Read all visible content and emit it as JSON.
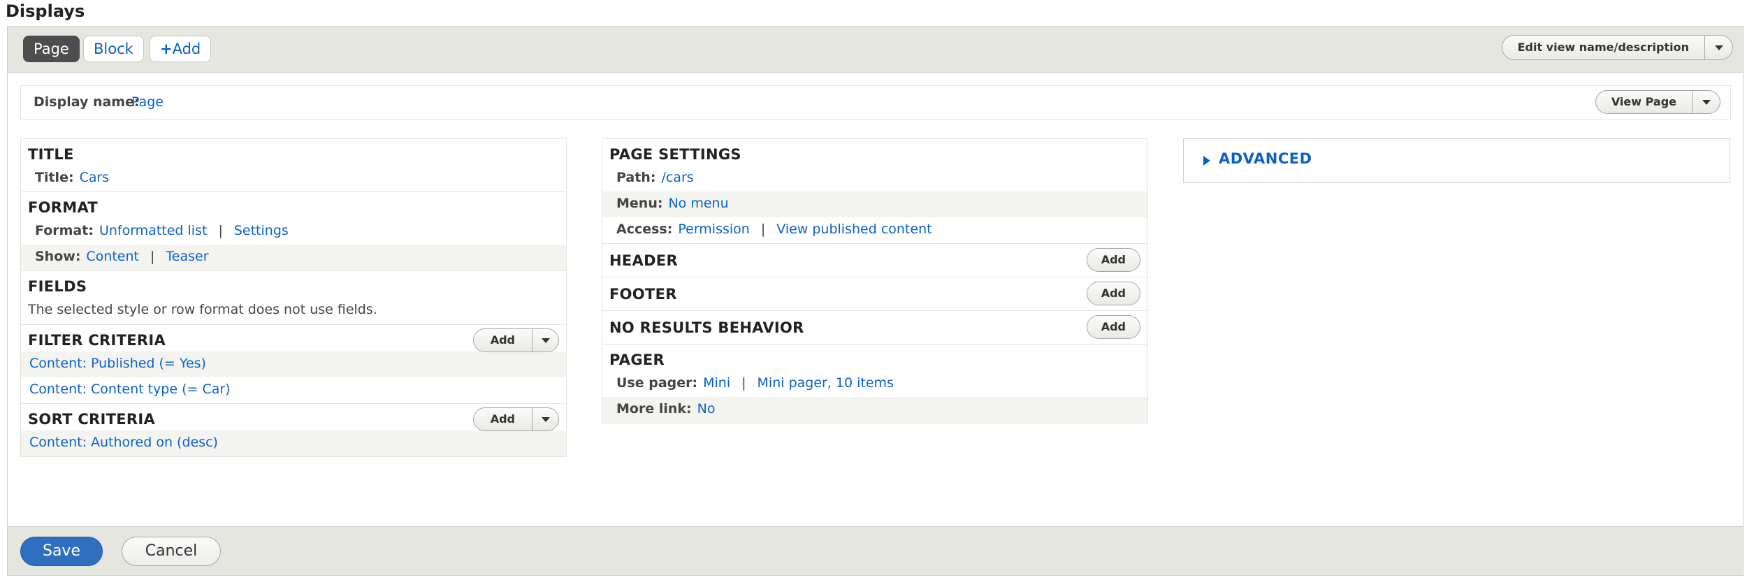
{
  "heading": "Displays",
  "tabs": {
    "page": "Page",
    "block": "Block",
    "add": "Add",
    "add_icon": "+"
  },
  "edit_view": "Edit view name/description",
  "display_name": {
    "label": "Display name:",
    "value": "Page"
  },
  "view_page": "View Page",
  "title_section": {
    "heading": "TITLE",
    "label": "Title:",
    "value": "Cars"
  },
  "format_section": {
    "heading": "FORMAT",
    "format_label": "Format:",
    "format_value": "Unformatted list",
    "settings": "Settings",
    "show_label": "Show:",
    "show_value": "Content",
    "show_mode": "Teaser",
    "separator": "|"
  },
  "fields_section": {
    "heading": "FIELDS",
    "text": "The selected style or row format does not use fields."
  },
  "filter_section": {
    "heading": "FILTER CRITERIA",
    "add": "Add",
    "items": [
      "Content: Published (= Yes)",
      "Content: Content type (= Car)"
    ]
  },
  "sort_section": {
    "heading": "SORT CRITERIA",
    "add": "Add",
    "items": [
      "Content: Authored on (desc)"
    ]
  },
  "page_settings": {
    "heading": "PAGE SETTINGS",
    "path_label": "Path:",
    "path_value": "/cars",
    "menu_label": "Menu:",
    "menu_value": "No menu",
    "access_label": "Access:",
    "access_value": "Permission",
    "access_detail": "View published content"
  },
  "header_section": {
    "heading": "HEADER",
    "add": "Add"
  },
  "footer_section": {
    "heading": "FOOTER",
    "add": "Add"
  },
  "no_results_section": {
    "heading": "NO RESULTS BEHAVIOR",
    "add": "Add"
  },
  "pager_section": {
    "heading": "PAGER",
    "use_pager_label": "Use pager:",
    "use_pager_value": "Mini",
    "pager_detail": "Mini pager, 10 items",
    "more_link_label": "More link:",
    "more_link_value": "No"
  },
  "advanced": "ADVANCED",
  "buttons": {
    "save": "Save",
    "cancel": "Cancel"
  },
  "colors": {
    "link": "#0b62c4",
    "primary": "#2f6fc0",
    "bar": "#e6e6e1",
    "active_tab": "#4e4e4e"
  }
}
